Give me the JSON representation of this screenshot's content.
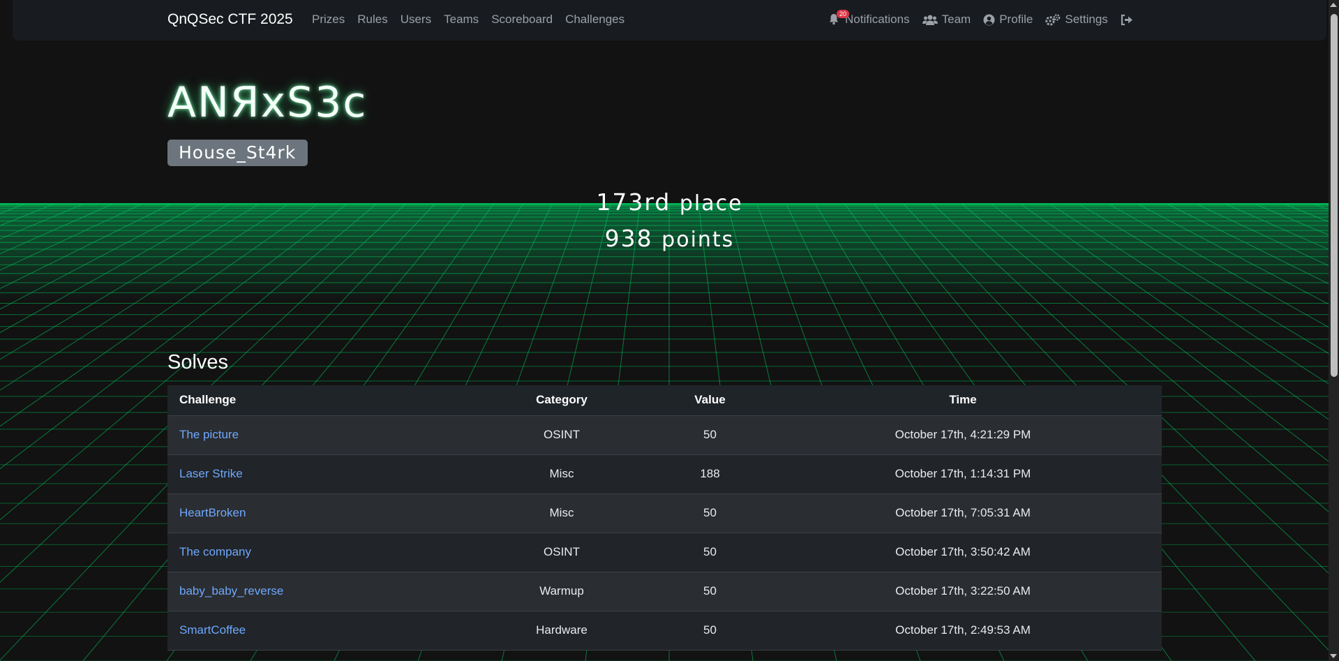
{
  "nav": {
    "brand": "QnQSec CTF 2025",
    "links": [
      "Prizes",
      "Rules",
      "Users",
      "Teams",
      "Scoreboard",
      "Challenges"
    ],
    "notifications_label": "Notifications",
    "notifications_count": "20",
    "team_label": "Team",
    "profile_label": "Profile",
    "settings_label": "Settings"
  },
  "team": {
    "name": "ANЯxS3c",
    "affiliation": "House_St4rk",
    "place_number": "173rd",
    "place_suffix": "place",
    "points_number": "938",
    "points_suffix": "points"
  },
  "solves": {
    "title": "Solves",
    "headers": [
      "Challenge",
      "Category",
      "Value",
      "Time"
    ],
    "rows": [
      {
        "challenge": "The picture",
        "category": "OSINT",
        "value": "50",
        "time": "October 17th, 4:21:29 PM"
      },
      {
        "challenge": "Laser Strike",
        "category": "Misc",
        "value": "188",
        "time": "October 17th, 1:14:31 PM"
      },
      {
        "challenge": "HeartBroken",
        "category": "Misc",
        "value": "50",
        "time": "October 17th, 7:05:31 AM"
      },
      {
        "challenge": "The company",
        "category": "OSINT",
        "value": "50",
        "time": "October 17th, 3:50:42 AM"
      },
      {
        "challenge": "baby_baby_reverse",
        "category": "Warmup",
        "value": "50",
        "time": "October 17th, 3:22:50 AM"
      },
      {
        "challenge": "SmartCoffee",
        "category": "Hardware",
        "value": "50",
        "time": "October 17th, 2:49:53 AM"
      }
    ]
  },
  "colors": {
    "background": "#121212",
    "grid": "#00d060",
    "link": "#6ea8fe",
    "badge": "#dc3545"
  }
}
